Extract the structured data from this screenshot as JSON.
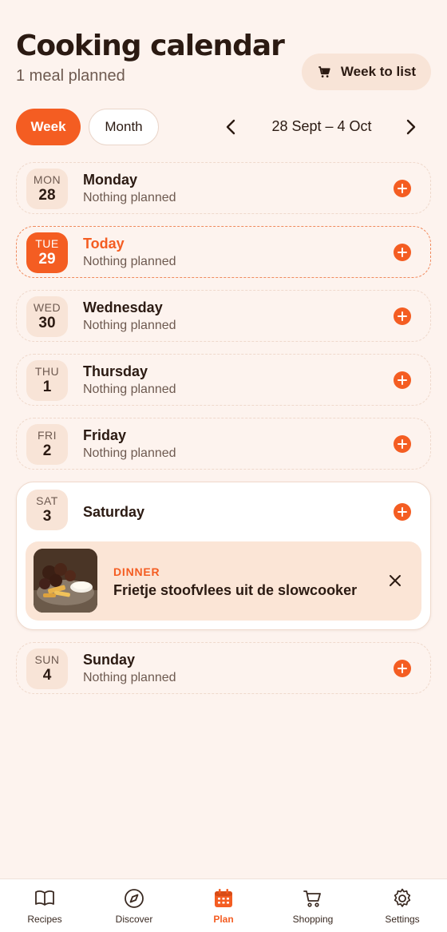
{
  "header": {
    "title": "Cooking calendar",
    "subtitle": "1 meal planned",
    "week_to_list_label": "Week to list",
    "week_to_list_icon": "cart-icon"
  },
  "controls": {
    "view_modes": [
      {
        "label": "Week",
        "selected": true
      },
      {
        "label": "Month",
        "selected": false
      }
    ],
    "range": "28 Sept – 4 Oct"
  },
  "days": [
    {
      "dow": "MON",
      "num": "28",
      "name": "Monday",
      "status": "Nothing planned"
    },
    {
      "dow": "TUE",
      "num": "29",
      "name": "Today",
      "status": "Nothing planned",
      "is_today": true
    },
    {
      "dow": "WED",
      "num": "30",
      "name": "Wednesday",
      "status": "Nothing planned"
    },
    {
      "dow": "THU",
      "num": "1",
      "name": "Thursday",
      "status": "Nothing planned"
    },
    {
      "dow": "FRI",
      "num": "2",
      "name": "Friday",
      "status": "Nothing planned"
    },
    {
      "dow": "SAT",
      "num": "3",
      "name": "Saturday",
      "meals": [
        {
          "type": "DINNER",
          "name": "Frietje stoofvlees uit de slowcooker"
        }
      ]
    },
    {
      "dow": "SUN",
      "num": "4",
      "name": "Sunday",
      "status": "Nothing planned"
    }
  ],
  "bottom_nav": [
    {
      "label": "Recipes",
      "icon": "book-icon"
    },
    {
      "label": "Discover",
      "icon": "compass-icon"
    },
    {
      "label": "Plan",
      "icon": "calendar-icon",
      "active": true
    },
    {
      "label": "Shopping",
      "icon": "cart-icon"
    },
    {
      "label": "Settings",
      "icon": "gear-icon"
    }
  ],
  "colors": {
    "accent": "#F45D22",
    "background": "#FDF3EE",
    "badge": "#F8E4D7",
    "text": "#2B1A12",
    "muted": "#6E5A50"
  }
}
